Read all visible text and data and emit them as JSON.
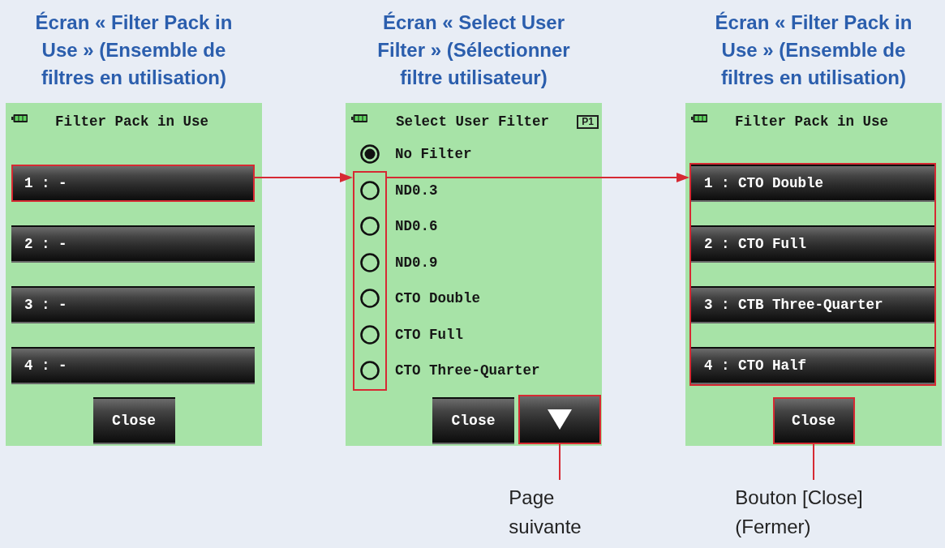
{
  "panels": [
    {
      "kind": "pack",
      "caption": "Écran « Filter Pack in\nUse » (Ensemble de\nfiltres en utilisation)",
      "screen": {
        "title": "Filter Pack in Use",
        "slots_framed": false,
        "slots": [
          {
            "label": "1 : -",
            "highlighted": true
          },
          {
            "label": "2 : -",
            "highlighted": false
          },
          {
            "label": "3 : -",
            "highlighted": false
          },
          {
            "label": "4 : -",
            "highlighted": false
          }
        ],
        "close_button": {
          "label": "Close",
          "highlighted": false
        }
      }
    },
    {
      "kind": "select",
      "caption": "Écran « Select User\nFilter » (Sélectionner\nfiltre utilisateur)",
      "screen": {
        "title": "Select User Filter",
        "page_indicator": "P1",
        "option_groups": [
          {
            "framed": false,
            "items": [
              {
                "label": "No Filter",
                "selected": true
              }
            ]
          },
          {
            "framed": true,
            "items": [
              {
                "label": "ND0.3",
                "selected": false
              },
              {
                "label": "ND0.6",
                "selected": false
              },
              {
                "label": "ND0.9",
                "selected": false
              },
              {
                "label": "CTO Double",
                "selected": false
              },
              {
                "label": "CTO Full",
                "selected": false
              },
              {
                "label": "CTO Three-Quarter",
                "selected": false
              }
            ]
          }
        ],
        "close_button": {
          "label": "Close",
          "highlighted": false
        },
        "next_button": {
          "highlighted": true,
          "callout": "Page\nsuivante"
        }
      }
    },
    {
      "kind": "pack",
      "caption": "Écran « Filter Pack in\nUse » (Ensemble de\nfiltres en utilisation)",
      "screen": {
        "title": "Filter Pack in Use",
        "slots_framed": true,
        "slots": [
          {
            "label": "1 : CTO Double",
            "highlighted": false
          },
          {
            "label": "2 : CTO Full",
            "highlighted": false
          },
          {
            "label": "3 : CTB Three-Quarter",
            "highlighted": false
          },
          {
            "label": "4 : CTO Half",
            "highlighted": false
          }
        ],
        "close_button": {
          "label": "Close",
          "highlighted": true,
          "callout": "Bouton [Close]\n(Fermer)"
        }
      }
    }
  ]
}
